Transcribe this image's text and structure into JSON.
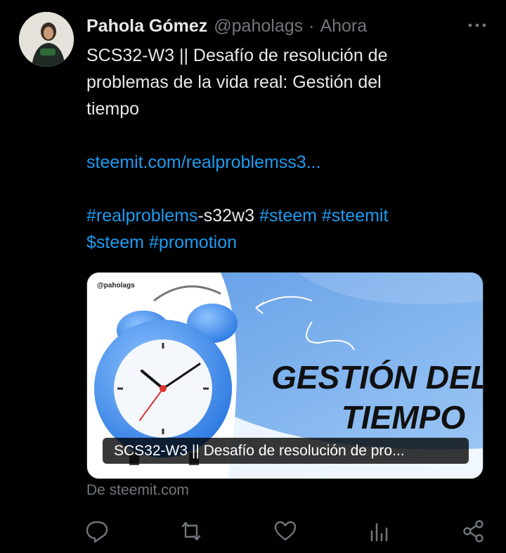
{
  "author": {
    "name": "Pahola Gómez",
    "handle": "@paholags",
    "separator": "·",
    "time": "Ahora"
  },
  "tweet": {
    "line1": "SCS32-W3 || Desafío de resolución de",
    "line2": "problemas de la vida real: Gestión del",
    "line3": "tiempo",
    "link": "steemit.com/realproblemss3...",
    "tags": {
      "realproblems": "#realproblems",
      "realproblems_suffix": "-s32w3",
      "steem": "#steem",
      "steemit": "#steemit",
      "cashtag_steem": "$steem",
      "promotion": "#promotion"
    }
  },
  "card": {
    "handle": "@paholags",
    "title": "SCS32-W3 || Desafío de resolución de pro...",
    "image_heading_line1": "GESTIÓN DEL",
    "image_heading_line2": "TIEMPO"
  },
  "source": "De steemit.com",
  "icons": {
    "more": "more-horizontal-icon",
    "reply": "reply-icon",
    "retweet": "retweet-icon",
    "like": "heart-icon",
    "views": "views-icon",
    "share": "share-icon"
  },
  "colors": {
    "background": "#000000",
    "text": "#e7e9ea",
    "secondary": "#71767b",
    "link": "#1d9bf0"
  }
}
